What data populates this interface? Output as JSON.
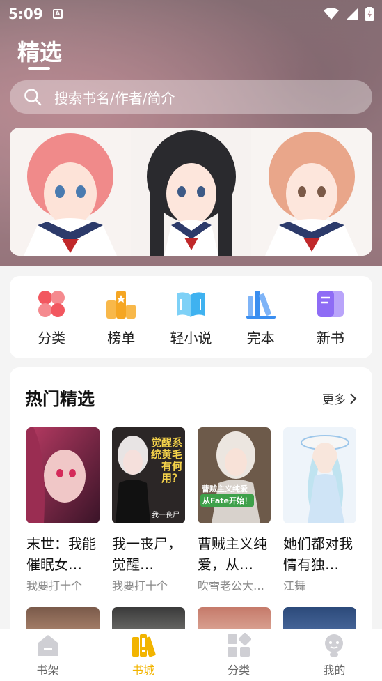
{
  "status_bar": {
    "time": "5:09",
    "notification_letter": "A"
  },
  "header": {
    "title": "精选"
  },
  "search": {
    "placeholder": "搜索书名/作者/简介"
  },
  "categories": [
    {
      "label": "分类",
      "icon": "clover-icon",
      "color": "#f2575f"
    },
    {
      "label": "榜单",
      "icon": "ranking-icon",
      "color": "#f5a623"
    },
    {
      "label": "轻小说",
      "icon": "open-book-icon",
      "color": "#3fb2f0"
    },
    {
      "label": "完本",
      "icon": "bookshelf-icon",
      "color": "#3a8ef0"
    },
    {
      "label": "新书",
      "icon": "new-book-icon",
      "color": "#8e6cf5"
    }
  ],
  "hot": {
    "title": "热门精选",
    "more": "更多",
    "books": [
      {
        "title": "末世：我能催眠女…",
        "author": "我要打十个",
        "cover_color": "#7a2a45"
      },
      {
        "title": "我一丧尸，觉醒…",
        "author": "我要打十个",
        "cover_color": "#2a2222",
        "cover_text": "觉醒系统黄毛有何用？",
        "cover_subtext": "我一丧尸"
      },
      {
        "title": "曹贼主义纯爱，从…",
        "author": "吹雪老公大…",
        "cover_color": "#6d5a4a",
        "cover_text": "曹贼主义纯爱",
        "cover_subtext": "从Fate开始！"
      },
      {
        "title": "她们都对我情有独…",
        "author": "江舞",
        "cover_color": "#d9e8f5"
      }
    ]
  },
  "bottom_nav": [
    {
      "label": "书架",
      "icon": "bookshelf-tab-icon",
      "active": false
    },
    {
      "label": "书城",
      "icon": "bookstore-tab-icon",
      "active": true
    },
    {
      "label": "分类",
      "icon": "category-tab-icon",
      "active": false
    },
    {
      "label": "我的",
      "icon": "profile-tab-icon",
      "active": false
    }
  ],
  "colors": {
    "accent": "#f2b400",
    "background": "#f4f4f4"
  }
}
